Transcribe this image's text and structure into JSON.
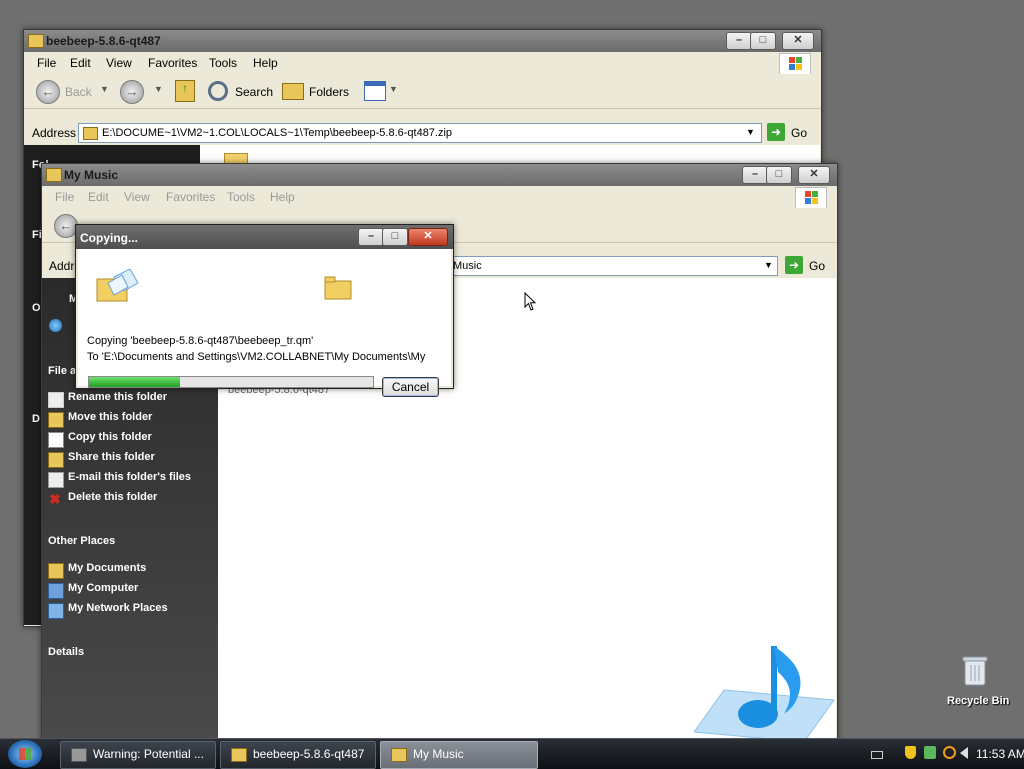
{
  "win_back": {
    "title": "beebeep-5.8.6-qt487",
    "menu": [
      "File",
      "Edit",
      "View",
      "Favorites",
      "Tools",
      "Help"
    ],
    "toolbar": {
      "back": "Back",
      "search": "Search",
      "folders": "Folders"
    },
    "address_label": "Address",
    "address_value": "E:\\DOCUME~1\\VM2~1.COL\\LOCALS~1\\Temp\\beebeep-5.8.6-qt487.zip",
    "go": "Go",
    "partial_labels": [
      "Folder Tasks",
      "Fi",
      "O",
      "D"
    ]
  },
  "win_front": {
    "title": "My Music",
    "menu": [
      "File",
      "Edit",
      "View",
      "Favorites",
      "Tools",
      "Help"
    ],
    "address_label": "Addr",
    "address_value": "Music",
    "go": "Go",
    "tasks_header": "File a",
    "tasks": [
      {
        "label": "Rename this folder",
        "icon": "rename-icon"
      },
      {
        "label": "Move this folder",
        "icon": "move-icon"
      },
      {
        "label": "Copy this folder",
        "icon": "copy-icon"
      },
      {
        "label": "Share this folder",
        "icon": "share-icon"
      },
      {
        "label": "E-mail this folder's files",
        "icon": "email-icon"
      },
      {
        "label": "Delete this folder",
        "icon": "delete-icon"
      }
    ],
    "other_places_header": "Other Places",
    "other_places": [
      {
        "label": "My Documents",
        "icon": "my-documents-icon"
      },
      {
        "label": "My Computer",
        "icon": "my-computer-icon"
      },
      {
        "label": "My Network Places",
        "icon": "network-icon"
      }
    ],
    "details_header": "Details",
    "file_item": "beebeep-5.8.6-qt487",
    "partial_sidebar": "M"
  },
  "copy_dialog": {
    "title": "Copying...",
    "line1": "Copying 'beebeep-5.8.6-qt487\\beebeep_tr.qm'",
    "line2": "To 'E:\\Documents and Settings\\VM2.COLLABNET\\My Documents\\My",
    "progress": 0.32,
    "cancel": "Cancel"
  },
  "desktop": {
    "recycle_bin": "Recycle Bin"
  },
  "taskbar": {
    "items": [
      {
        "label": "Warning: Potential ...",
        "active": false
      },
      {
        "label": "beebeep-5.8.6-qt487",
        "active": false
      },
      {
        "label": "My Music",
        "active": true
      }
    ],
    "clock": "11:53 AM"
  },
  "colors": {
    "progress_fill": "#2bb52b",
    "task_pane": "#3a3a3a",
    "accent_music": "#1a8fe0"
  }
}
